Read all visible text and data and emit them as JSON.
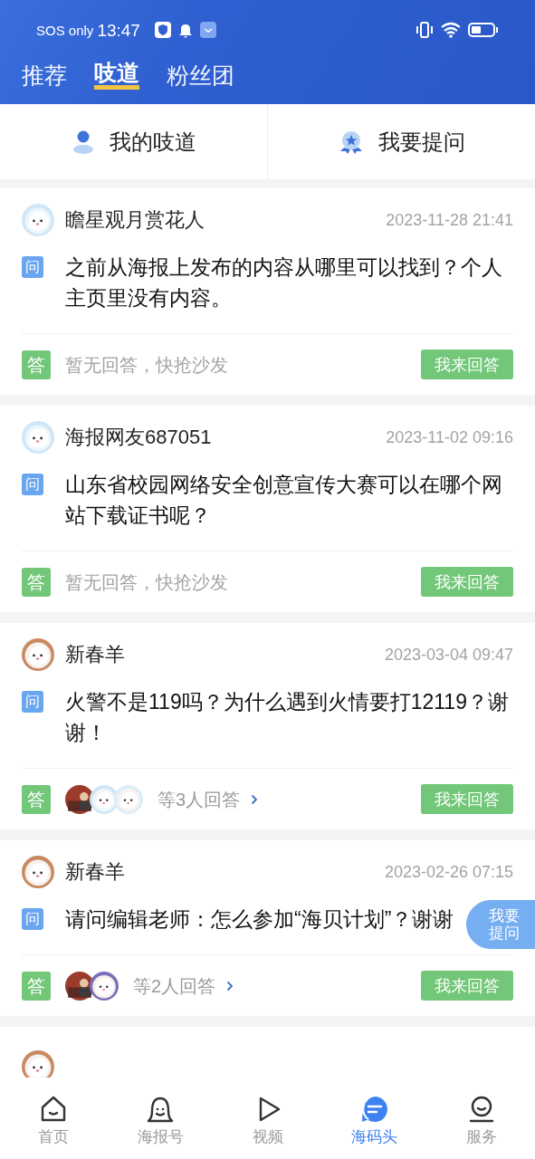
{
  "status_bar": {
    "carrier": "SOS only",
    "time": "13:47"
  },
  "top_tabs": [
    {
      "label": "推荐",
      "selected": false
    },
    {
      "label": "吱道",
      "selected": true
    },
    {
      "label": "粉丝团",
      "selected": false
    }
  ],
  "sub_tabs": [
    {
      "label": "我的吱道",
      "kind": "person"
    },
    {
      "label": "我要提问",
      "kind": "badge"
    }
  ],
  "questions": [
    {
      "user": "瞻星观月赏花人",
      "time": "2023-11-28 21:41",
      "q_mark": "问",
      "question": "之前从海报上发布的内容从哪里可以找到？个人主页里没有内容。",
      "a_mark": "答",
      "kind": "empty",
      "answer_text": "暂无回答，快抢沙发",
      "button": "我来回答"
    },
    {
      "user": "海报网友687051",
      "time": "2023-11-02 09:16",
      "q_mark": "问",
      "question": "山东省校园网络安全创意宣传大赛可以在哪个网站下载证书呢？",
      "a_mark": "答",
      "kind": "empty",
      "answer_text": "暂无回答，快抢沙发",
      "button": "我来回答"
    },
    {
      "user": "新春羊",
      "time": "2023-03-04 09:47",
      "q_mark": "问",
      "question": "火警不是119吗？为什么遇到火情要打12119？谢谢！",
      "a_mark": "答",
      "kind": "answered",
      "answer_text": "等3人回答",
      "button": "我来回答"
    },
    {
      "user": "新春羊",
      "time": "2023-02-26 07:15",
      "q_mark": "问",
      "question": "请问编辑老师：怎么参加“海贝计划”？谢谢",
      "a_mark": "答",
      "kind": "answered",
      "answer_text": "等2人回答",
      "button": "我来回答"
    }
  ],
  "float_button": {
    "lines": [
      "我要",
      "提问"
    ]
  },
  "bottom_nav": [
    {
      "label": "首页",
      "selected": false
    },
    {
      "label": "海报号",
      "selected": false
    },
    {
      "label": "视频",
      "selected": false
    },
    {
      "label": "海码头",
      "selected": true
    },
    {
      "label": "服务",
      "selected": false
    }
  ]
}
